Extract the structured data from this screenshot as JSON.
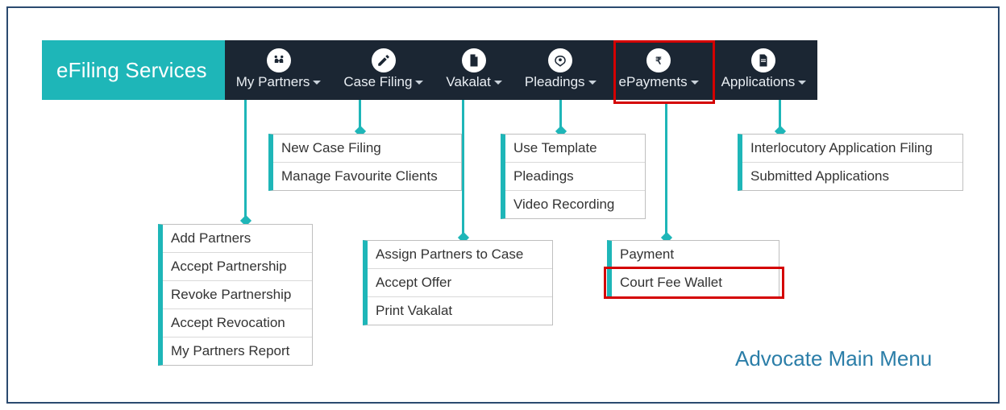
{
  "brand": "eFiling Services",
  "nav": [
    {
      "key": "my-partners",
      "label": "My Partners",
      "icon": "partners"
    },
    {
      "key": "case-filing",
      "label": "Case Filing",
      "icon": "pencil"
    },
    {
      "key": "vakalat",
      "label": "Vakalat",
      "icon": "doc"
    },
    {
      "key": "pleadings",
      "label": "Pleadings",
      "icon": "hands"
    },
    {
      "key": "epayments",
      "label": "ePayments",
      "icon": "rupee"
    },
    {
      "key": "applications",
      "label": "Applications",
      "icon": "doc2"
    }
  ],
  "menus": {
    "my_partners": [
      "Add Partners",
      "Accept Partnership",
      "Revoke Partnership",
      "Accept Revocation",
      "My Partners Report"
    ],
    "case_filing": [
      "New Case Filing",
      "Manage Favourite Clients"
    ],
    "vakalat": [
      "Assign Partners to Case",
      "Accept Offer",
      "Print Vakalat"
    ],
    "pleadings": [
      "Use Template",
      "Pleadings",
      "Video Recording"
    ],
    "epayments": [
      "Payment",
      "Court Fee Wallet"
    ],
    "applications": [
      "Interlocutory Application Filing",
      "Submitted Applications"
    ]
  },
  "caption": "Advocate Main Menu"
}
